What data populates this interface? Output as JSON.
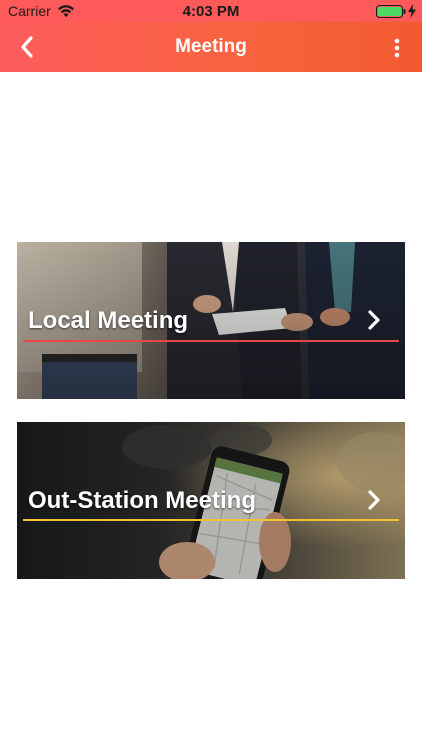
{
  "status_bar": {
    "carrier": "Carrier",
    "time": "4:03 PM",
    "background_color": "#ff5a5a",
    "battery_color": "#4cd964"
  },
  "nav_bar": {
    "title": "Meeting",
    "back_icon": "chevron-left-icon",
    "menu_icon": "vertical-dots-icon",
    "gradient_start": "#ff5d5d",
    "gradient_end": "#f25a30"
  },
  "meeting_options": [
    {
      "label": "Local Meeting",
      "chevron_icon": "chevron-right-icon",
      "underline_color": "#e8474a"
    },
    {
      "label": "Out-Station Meeting",
      "chevron_icon": "chevron-right-icon",
      "underline_color": "#f2c230"
    }
  ]
}
